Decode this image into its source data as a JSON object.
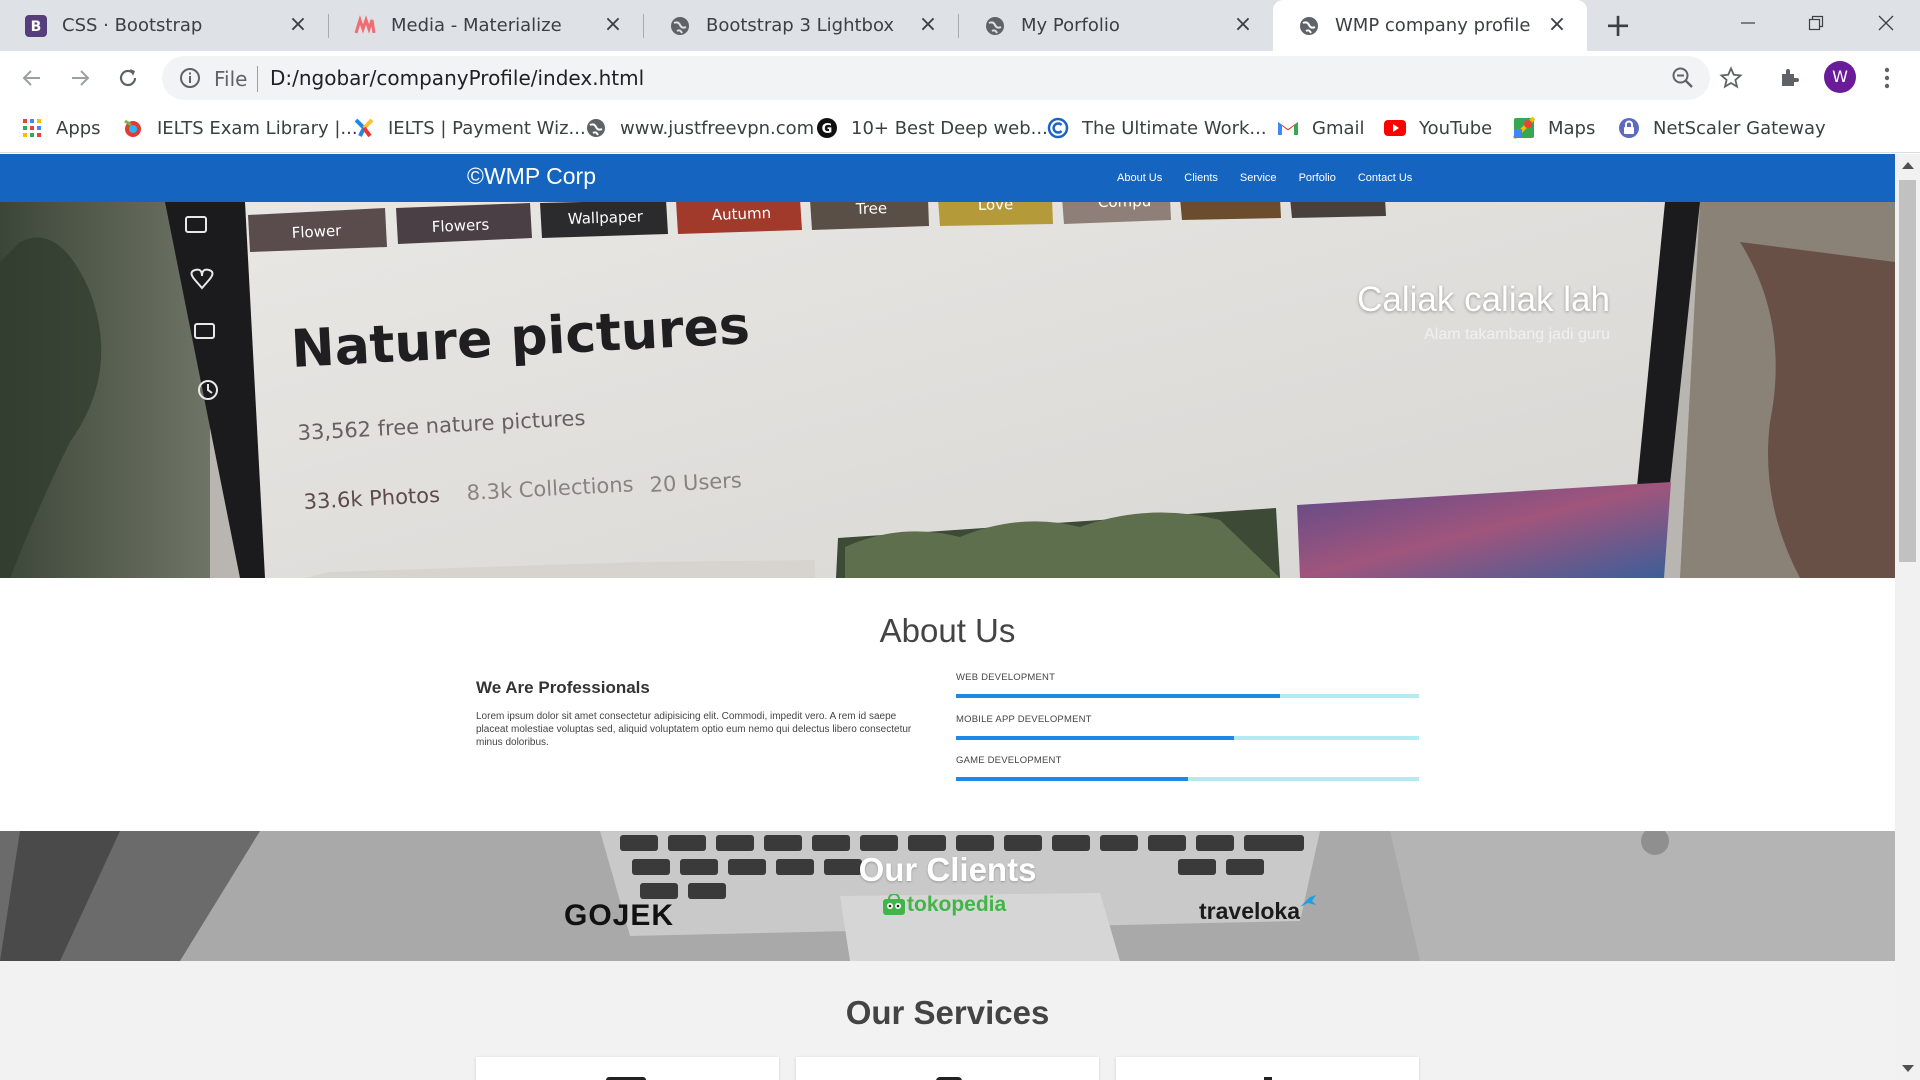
{
  "browser": {
    "tabs": [
      {
        "title": "CSS · Bootstrap",
        "icon": "bootstrap-icon",
        "active": false
      },
      {
        "title": "Media - Materialize",
        "icon": "materialize-icon",
        "active": false
      },
      {
        "title": "Bootstrap 3 Lightbox",
        "icon": "globe-icon",
        "active": false
      },
      {
        "title": "My Porfolio",
        "icon": "globe-icon",
        "active": false
      },
      {
        "title": "WMP company profile",
        "icon": "globe-icon",
        "active": true
      }
    ],
    "address": {
      "scheme_label": "File",
      "url": "D:/ngobar/companyProfile/index.html"
    },
    "profile_initial": "W",
    "bookmarks": [
      {
        "label": "Apps",
        "icon": "apps-grid-icon"
      },
      {
        "label": "IELTS Exam Library |...",
        "icon": "ielts-icon"
      },
      {
        "label": "IELTS | Payment Wiz...",
        "icon": "payment-icon"
      },
      {
        "label": "www.justfreevpn.com",
        "icon": "globe-icon"
      },
      {
        "label": "10+ Best Deep web...",
        "icon": "g-icon"
      },
      {
        "label": "The Ultimate Work...",
        "icon": "copyright-icon"
      },
      {
        "label": "Gmail",
        "icon": "gmail-icon"
      },
      {
        "label": "YouTube",
        "icon": "youtube-icon"
      },
      {
        "label": "Maps",
        "icon": "maps-icon"
      },
      {
        "label": "NetScaler Gateway",
        "icon": "lock-icon"
      }
    ]
  },
  "site": {
    "brand": "©WMP Corp",
    "nav": [
      "About Us",
      "Clients",
      "Service",
      "Porfolio",
      "Contact Us"
    ],
    "colors": {
      "primary": "#1565c0",
      "progress": "#1e88e5",
      "progress_track": "#b2ebf2"
    },
    "hero": {
      "caption_title": "Caliak caliak lah",
      "caption_subtitle": "Alam takambang jadi guru",
      "screen": {
        "chips": [
          "Flower",
          "Flowers",
          "Wallpaper",
          "Autumn",
          "Tree",
          "Love",
          "Compu"
        ],
        "heading": "Nature pictures",
        "count": "33,562 free nature pictures",
        "stats": [
          "33.6k Photos",
          "8.3k Collections",
          "20 Users"
        ]
      }
    },
    "about": {
      "title": "About Us",
      "subtitle": "We Are Professionals",
      "text": "Lorem ipsum dolor sit amet consectetur adipisicing elit. Commodi, impedit vero. A rem id saepe placeat molestiae voluptas sed, aliquid voluptatem optio eum nemo qui delectus libero consectetur minus doloribus.",
      "skills": [
        {
          "label": "WEB DEVELOPMENT",
          "percent": 70
        },
        {
          "label": "MOBILE APP DEVELOPMENT",
          "percent": 60
        },
        {
          "label": "GAME DEVELOPMENT",
          "percent": 50
        }
      ]
    },
    "clients": {
      "title": "Our Clients",
      "logos": [
        "GOJEK",
        "tokopedia",
        "traveloka"
      ]
    },
    "services": {
      "title": "Our Services"
    }
  }
}
